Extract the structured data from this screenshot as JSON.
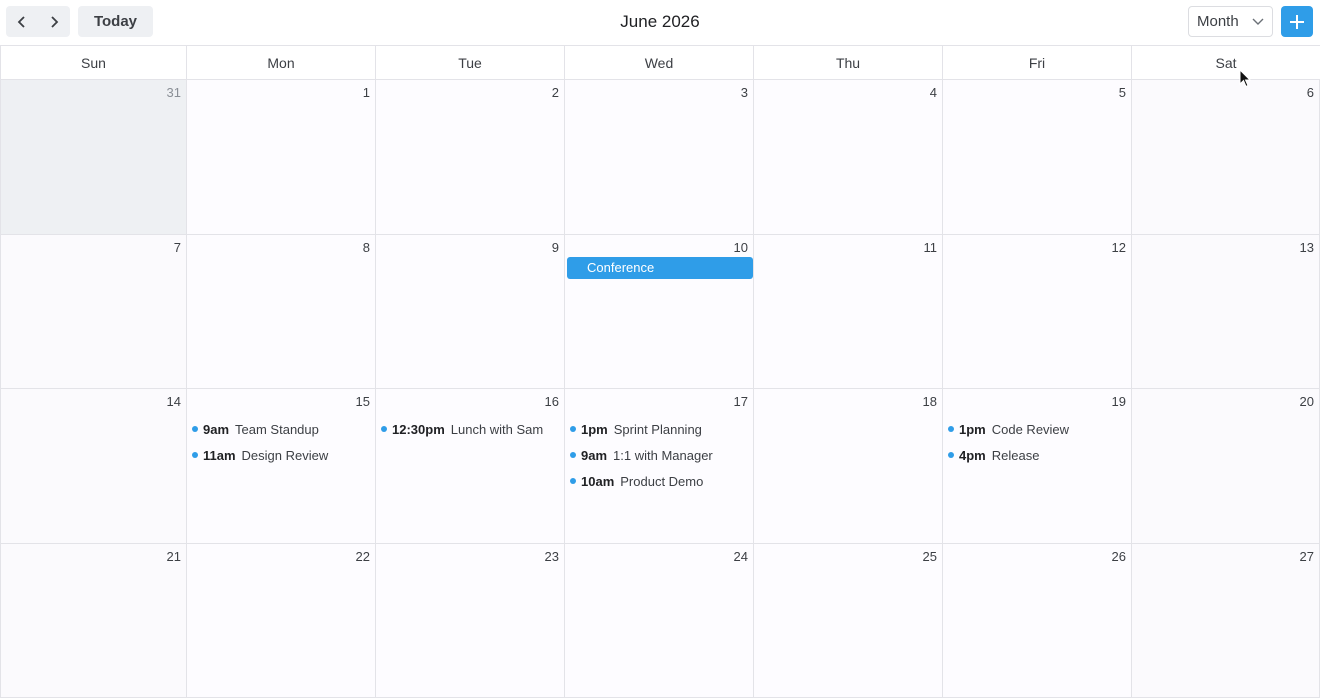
{
  "toolbar": {
    "prev_icon": "chevron-left-icon",
    "next_icon": "chevron-right-icon",
    "today_label": "Today",
    "title": "June 2026",
    "view_select": "Month",
    "add_icon": "plus-icon"
  },
  "weekdays": [
    "Sun",
    "Mon",
    "Tue",
    "Wed",
    "Thu",
    "Fri",
    "Sat"
  ],
  "weeks": [
    {
      "days": [
        {
          "num": "31",
          "other": true,
          "events": []
        },
        {
          "num": "1",
          "events": []
        },
        {
          "num": "2",
          "events": []
        },
        {
          "num": "3",
          "events": []
        },
        {
          "num": "4",
          "events": []
        },
        {
          "num": "5",
          "events": []
        },
        {
          "num": "6",
          "events": []
        }
      ]
    },
    {
      "days": [
        {
          "num": "7",
          "events": []
        },
        {
          "num": "8",
          "events": []
        },
        {
          "num": "9",
          "events": []
        },
        {
          "num": "10",
          "events": []
        },
        {
          "num": "11",
          "events": []
        },
        {
          "num": "12",
          "events": []
        },
        {
          "num": "13",
          "events": []
        }
      ],
      "allday": "Conference"
    },
    {
      "days": [
        {
          "num": "14",
          "events": []
        },
        {
          "num": "15",
          "events": [
            {
              "time": "9am",
              "title": "Team Standup"
            },
            {
              "time": "11am",
              "title": "Design Review"
            }
          ]
        },
        {
          "num": "16",
          "events": [
            {
              "time": "12:30pm",
              "title": "Lunch with Sam"
            }
          ]
        },
        {
          "num": "17",
          "events": [
            {
              "time": "1pm",
              "title": "Sprint Planning"
            },
            {
              "time": "9am",
              "title": "1:1 with Manager"
            },
            {
              "time": "10am",
              "title": "Product Demo"
            }
          ]
        },
        {
          "num": "18",
          "events": []
        },
        {
          "num": "19",
          "events": [
            {
              "time": "1pm",
              "title": "Code Review"
            },
            {
              "time": "4pm",
              "title": "Release"
            }
          ]
        },
        {
          "num": "20",
          "events": []
        }
      ]
    },
    {
      "days": [
        {
          "num": "21",
          "events": []
        },
        {
          "num": "22",
          "events": []
        },
        {
          "num": "23",
          "events": []
        },
        {
          "num": "24",
          "events": []
        },
        {
          "num": "25",
          "events": []
        },
        {
          "num": "26",
          "events": []
        },
        {
          "num": "27",
          "events": []
        }
      ]
    }
  ],
  "colors": {
    "accent": "#2f9de8",
    "other_month_bg": "#eef0f3"
  }
}
